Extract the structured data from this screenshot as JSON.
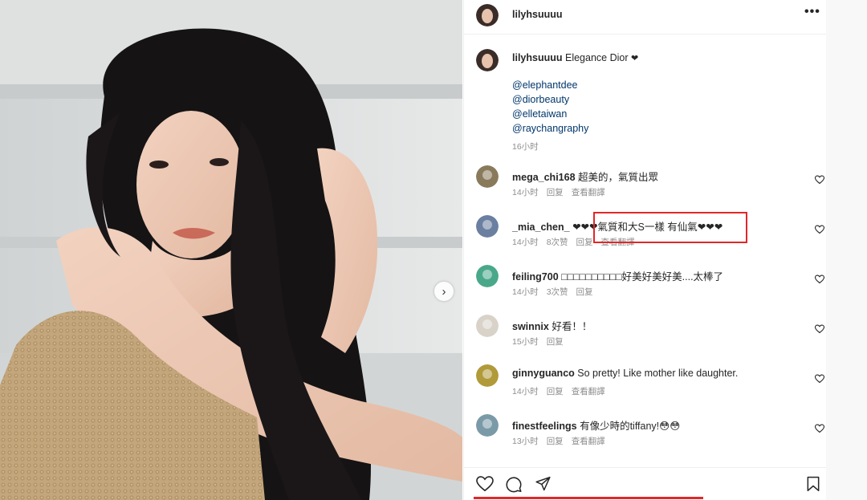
{
  "post": {
    "author": "lilyhsuuuu",
    "caption": "Elegance Dior",
    "caption_heart": "❤",
    "mentions": [
      "@elephantdee",
      "@diorbeauty",
      "@elletaiwan",
      "@raychangraphy"
    ],
    "caption_time": "16小时",
    "more_label": "•••",
    "next_arrow": "›"
  },
  "comments": [
    {
      "user": "mega_chi168",
      "text": "超美的，氣質出眾",
      "time": "14小时",
      "likes": "",
      "reply": "回复",
      "translate": "查看翻譯",
      "avatar_color": "#8a7a5c"
    },
    {
      "user": "_mia_chen_",
      "text": "❤❤❤氣質和大S一樣 有仙氣❤❤❤",
      "time": "14小时",
      "likes": "8次赞",
      "reply": "回复",
      "translate": "查看翻譯",
      "avatar_color": "#6b7fa0"
    },
    {
      "user": "feiling700",
      "text": "□□□□□□□□□□好美好美好美....太棒了",
      "time": "14小时",
      "likes": "3次赞",
      "reply": "回复",
      "translate": "",
      "avatar_color": "#4aa88a"
    },
    {
      "user": "swinnix",
      "text": "好看！！",
      "time": "15小时",
      "likes": "",
      "reply": "回复",
      "translate": "",
      "avatar_color": "#d8d2c8"
    },
    {
      "user": "ginnyguanco",
      "text": "So pretty! Like mother like daughter.",
      "time": "14小时",
      "likes": "",
      "reply": "回复",
      "translate": "查看翻譯",
      "avatar_color": "#b09a3a"
    },
    {
      "user": "finestfeelings",
      "text": "有像少時的tiffany!😳😳",
      "time": "13小时",
      "likes": "",
      "reply": "回复",
      "translate": "查看翻譯",
      "avatar_color": "#7a9aa8"
    }
  ],
  "colors": {
    "highlight": "#e02828",
    "mention": "#00376b",
    "meta": "#8e8e8e"
  },
  "icons": {
    "like": "heart-icon",
    "comment": "comment-bubble-icon",
    "share": "paper-plane-icon",
    "save": "bookmark-icon",
    "next": "chevron-right-icon",
    "more": "more-dots-icon"
  }
}
